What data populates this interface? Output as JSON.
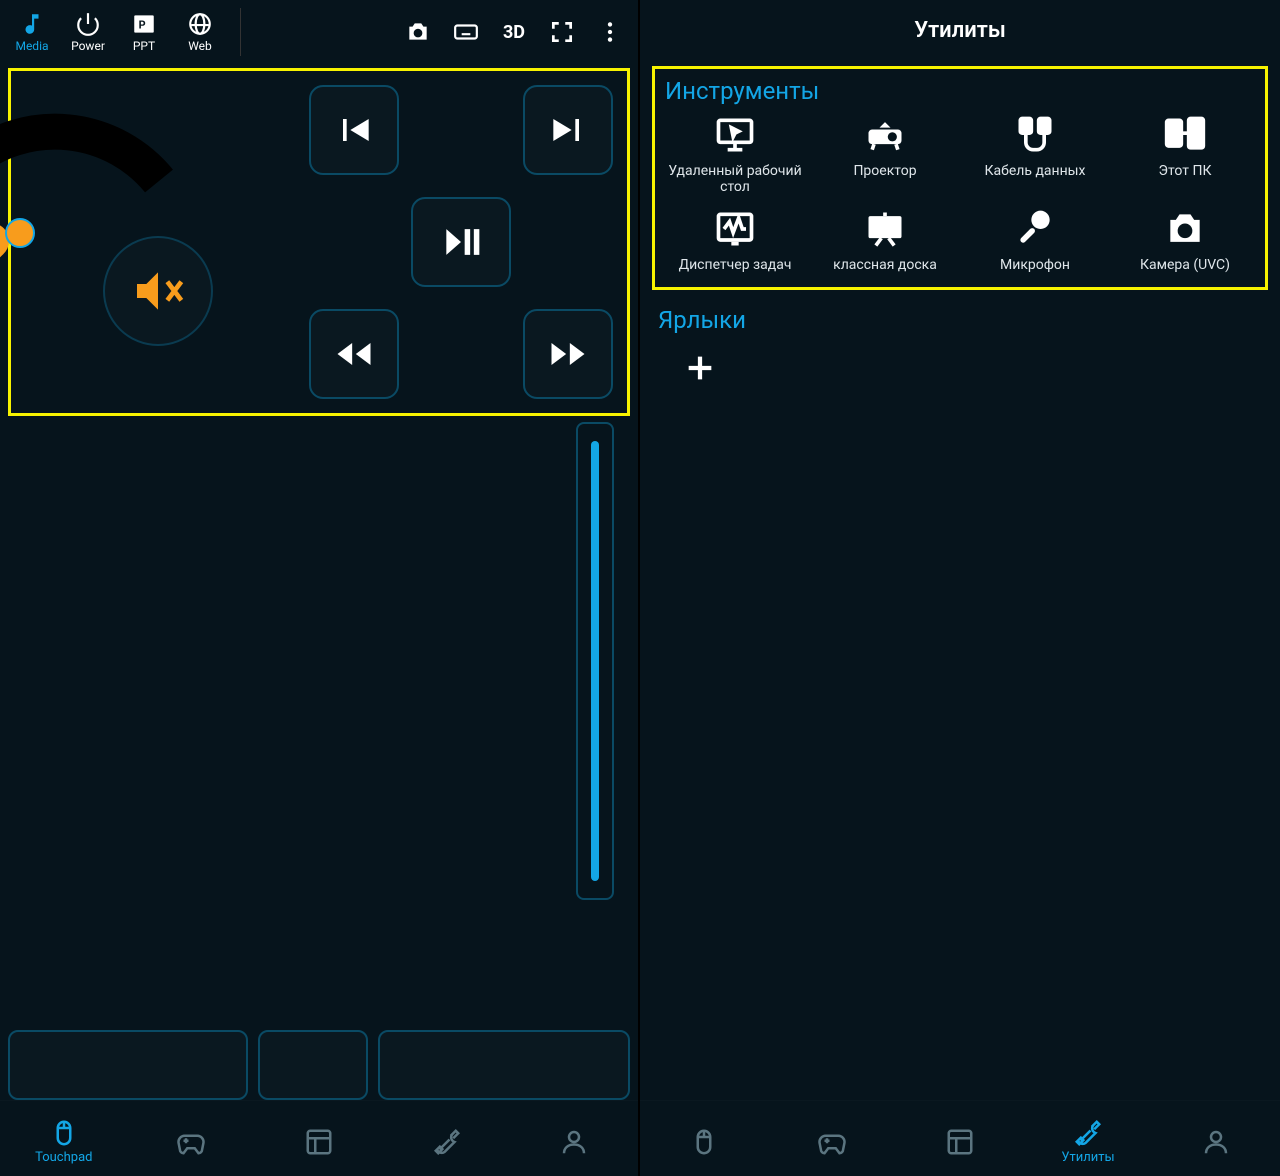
{
  "colors": {
    "accent": "#13a6e6",
    "highlight_border": "#f7f300",
    "warning": "#f89c1c"
  },
  "left": {
    "tabs": [
      {
        "id": "media",
        "label": "Media",
        "icon": "music-note-icon",
        "active": true
      },
      {
        "id": "power",
        "label": "Power",
        "icon": "power-icon",
        "active": false
      },
      {
        "id": "ppt",
        "label": "PPT",
        "icon": "powerpoint-icon",
        "active": false
      },
      {
        "id": "web",
        "label": "Web",
        "icon": "internet-explorer-icon",
        "active": false
      }
    ],
    "actions": [
      {
        "id": "camera",
        "icon": "camera-icon"
      },
      {
        "id": "keyboard",
        "icon": "keyboard-icon"
      },
      {
        "id": "three-d",
        "label": "3D"
      },
      {
        "id": "fullscreen",
        "icon": "fullscreen-icon"
      },
      {
        "id": "more",
        "icon": "vertical-dots-icon"
      }
    ],
    "media_buttons": {
      "prev": "previous-track-icon",
      "next": "next-track-icon",
      "playpause": "play-pause-icon",
      "rewind": "rewind-icon",
      "forward": "fast-forward-icon",
      "mute": "mute-icon"
    },
    "bottom_nav": [
      {
        "id": "touchpad",
        "label": "Touchpad",
        "icon": "mouse-icon",
        "active": true
      },
      {
        "id": "gamepad",
        "label": "",
        "icon": "gamepad-icon",
        "active": false
      },
      {
        "id": "layout",
        "label": "",
        "icon": "layout-icon",
        "active": false
      },
      {
        "id": "tools",
        "label": "",
        "icon": "wrench-screwdriver-icon",
        "active": false
      },
      {
        "id": "user",
        "label": "",
        "icon": "user-icon",
        "active": false
      }
    ]
  },
  "right": {
    "title": "Утилиты",
    "tools_heading": "Инструменты",
    "tools": [
      {
        "id": "remote-desktop",
        "label": "Удаленный рабочий стол",
        "icon": "monitor-cursor-icon"
      },
      {
        "id": "projector",
        "label": "Проектор",
        "icon": "projector-icon"
      },
      {
        "id": "data-cable",
        "label": "Кабель данных",
        "icon": "data-cable-icon"
      },
      {
        "id": "this-pc",
        "label": "Этот ПК",
        "icon": "phone-pc-icon"
      },
      {
        "id": "task-manager",
        "label": "Диспетчер задач",
        "icon": "activity-monitor-icon"
      },
      {
        "id": "whiteboard",
        "label": "классная доска",
        "icon": "whiteboard-icon"
      },
      {
        "id": "microphone",
        "label": "Микрофон",
        "icon": "microphone-icon"
      },
      {
        "id": "camera-uvc",
        "label": "Камера (UVC)",
        "icon": "camera-icon"
      }
    ],
    "shortcuts_heading": "Ярлыки",
    "shortcuts_add_icon": "plus-icon",
    "bottom_nav": [
      {
        "id": "touchpad",
        "label": "",
        "icon": "mouse-icon",
        "active": false
      },
      {
        "id": "gamepad",
        "label": "",
        "icon": "gamepad-icon",
        "active": false
      },
      {
        "id": "layout",
        "label": "",
        "icon": "layout-icon",
        "active": false
      },
      {
        "id": "tools",
        "label": "Утилиты",
        "icon": "wrench-screwdriver-icon",
        "active": true
      },
      {
        "id": "user",
        "label": "",
        "icon": "user-icon",
        "active": false
      }
    ]
  }
}
